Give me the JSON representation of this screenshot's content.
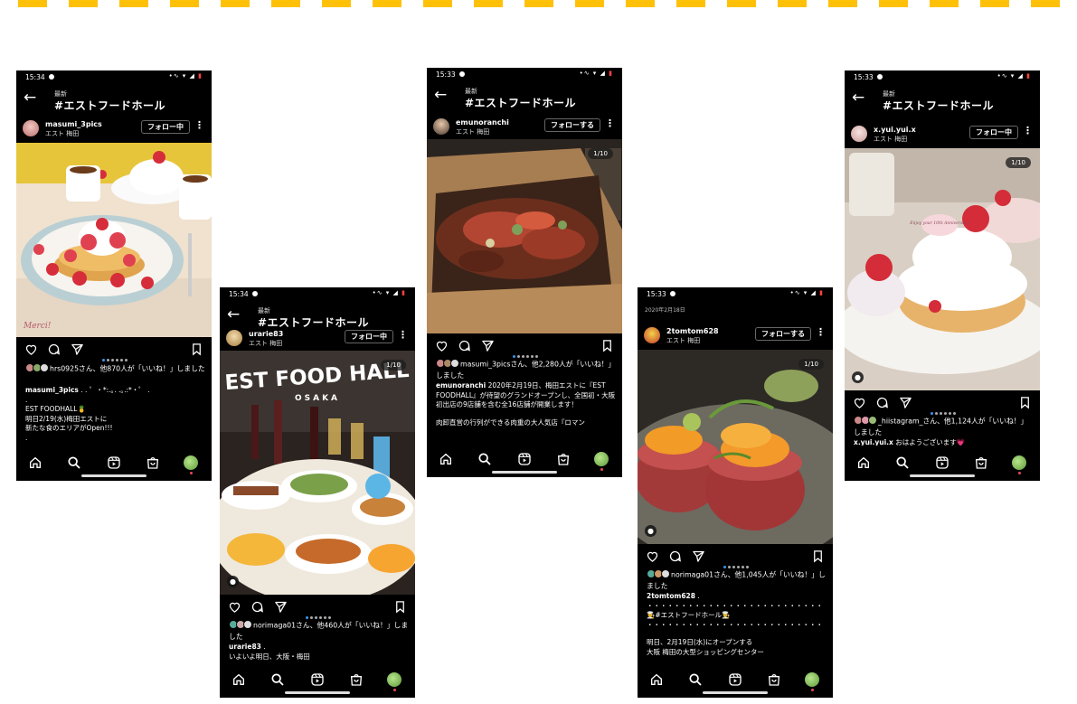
{
  "header": {
    "latest": "最新",
    "title": "#エストフードホール"
  },
  "nav_icons": [
    "home-icon",
    "search-icon",
    "reels-icon",
    "shop-icon",
    "profile-avatar"
  ],
  "action_icons": [
    "heart-icon",
    "comment-icon",
    "share-icon",
    "bookmark-icon"
  ],
  "colors": {
    "accent_yellow": "#ffc107",
    "background": "#000000",
    "link_blue": "#3897f0"
  },
  "phones": [
    {
      "time": "15:34",
      "user": "masumi_3pics",
      "location": "エスト 梅田",
      "follow": "フォロー中",
      "likes_text": "hrs0925さん、他870人が「いいね！」しました",
      "caption": [
        {
          "u": "masumi_3pics",
          "t": ". . ゜・*:.｡. .｡.:*・゜ ."
        },
        {
          "t": "."
        },
        {
          "t": "EST FOODHALL🍍"
        },
        {
          "t": "明日2/19(水)梅田エストに"
        },
        {
          "t": "新たな食のエリアがOpen!!!"
        },
        {
          "t": "."
        }
      ]
    },
    {
      "time": "15:34",
      "user": "urarie83",
      "location": "エスト 梅田",
      "follow": "フォロー中",
      "counter": "1/10",
      "photo_text": {
        "line1": "EST FOOD HALL",
        "line2": "OSAKA"
      },
      "likes_text": "norimaga01さん、他460人が「いいね！」しました",
      "caption": [
        {
          "u": "urarie83",
          "t": "."
        },
        {
          "t": "いよいよ明日、大阪・梅田"
        }
      ]
    },
    {
      "time": "15:33",
      "user": "emunoranchi",
      "location": "エスト 梅田",
      "follow": "フォローする",
      "counter": "1/10",
      "likes_text": "masumi_3picsさん、他2,280人が「いいね！」しました",
      "caption": [
        {
          "u": "emunoranchi",
          "t": "2020年2月19日、梅田エストに『EST FOODHALL』が待望のグランドオープンし、全国初・大阪初出店の9店舗を含む全16店舗が開業します！"
        },
        {
          "gap": true
        },
        {
          "t": "肉卸直営の行列ができる肉重の大人気店『ロマン"
        }
      ]
    },
    {
      "time": "15:33",
      "post_date": "2020年2月18日",
      "user": "2tomtom628",
      "location": "エスト 梅田",
      "follow": "フォローする",
      "counter": "1/10",
      "likes_text": "norimaga01さん、他1,045人が「いいね！」しました",
      "caption": [
        {
          "u": "2tomtom628",
          "t": "."
        },
        {
          "t": "・・・・・・・・・・・・・・・・・・・・・・・・・・"
        },
        {
          "t": "👨‍🍳#エストフードホール👨‍🍳"
        },
        {
          "t": "・・・・・・・・・・・・・・・・・・・・・・・・・・"
        },
        {
          "gap": true
        },
        {
          "t": "明日、2月19日(水)にオープンする"
        },
        {
          "t": "大阪 梅田の大型ショッピングセンター"
        }
      ]
    },
    {
      "time": "15:33",
      "user": "x.yui.yui.x",
      "location": "エスト 梅田",
      "follow": "フォロー中",
      "counter": "1/10",
      "photo_text": {
        "plate": "Enjoy your 10th Anniversary"
      },
      "likes_text": "_hiistagram_さん、他1,124人が「いいね！」しました",
      "caption": [
        {
          "u": "x.yui.yui.x",
          "t": "おはようございます💗"
        }
      ]
    }
  ]
}
